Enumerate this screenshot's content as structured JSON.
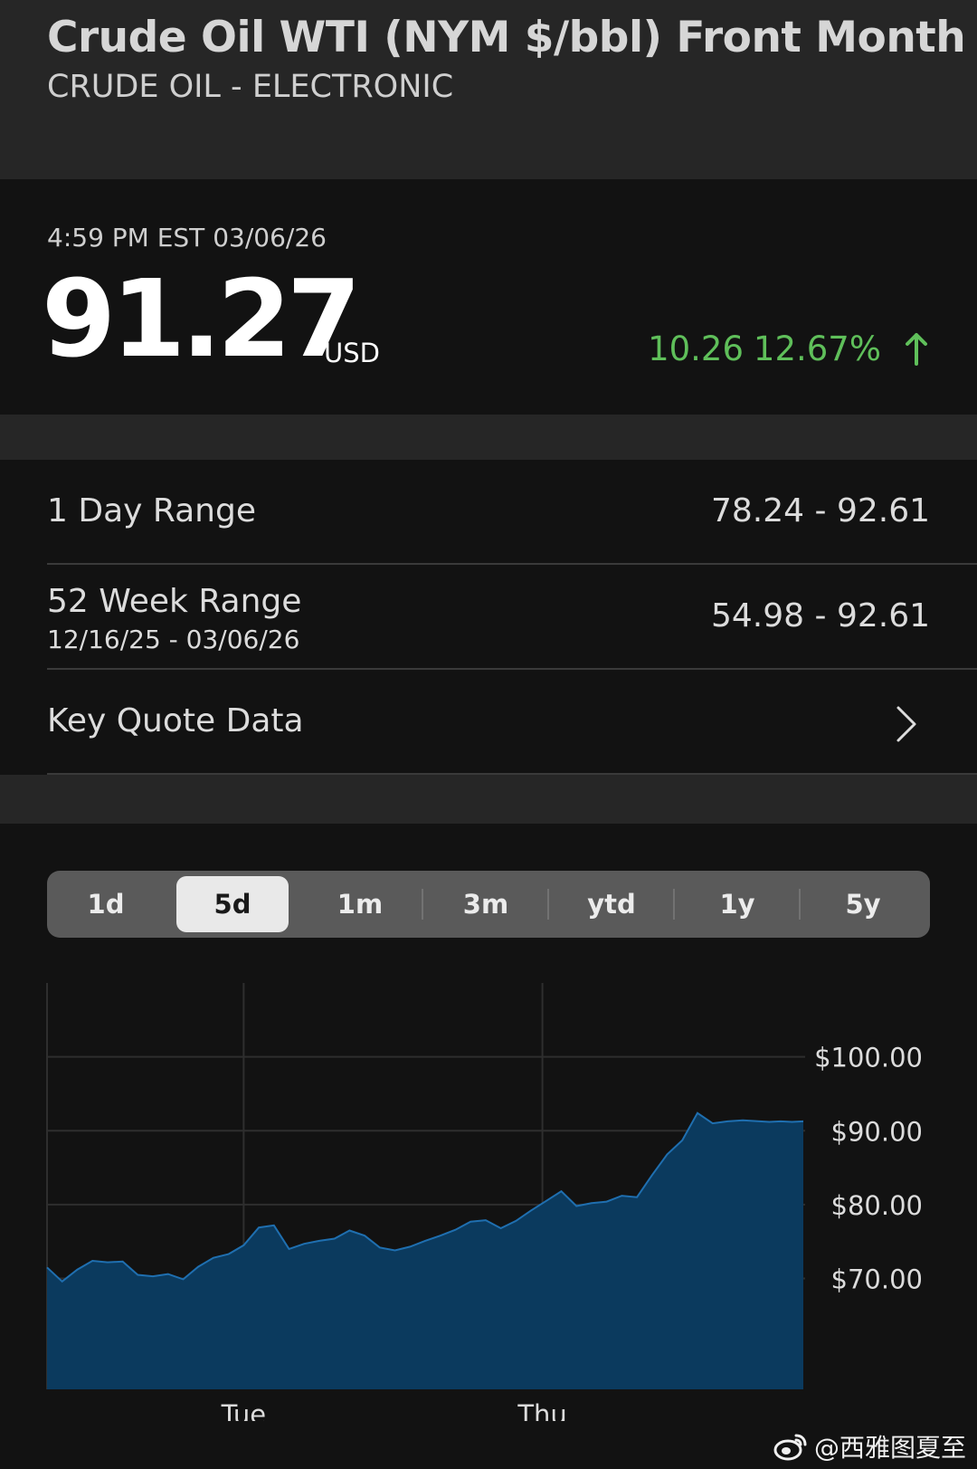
{
  "header": {
    "title": "Crude Oil WTI (NYM $/bbl) Front Month",
    "subtitle": "CRUDE OIL - ELECTRONIC"
  },
  "quote": {
    "timestamp": "4:59 PM EST 03/06/26",
    "price": "91.27",
    "currency": "USD",
    "change_abs": "10.26",
    "change_pct": "12.67%",
    "direction_icon": "arrow-up-icon",
    "change_color": "#5fbf5a"
  },
  "ranges": {
    "day": {
      "label": "1 Day Range",
      "value": "78.24 - 92.61"
    },
    "week52": {
      "label": "52 Week Range",
      "sublabel": "12/16/25 - 03/06/26",
      "value": "54.98 - 92.61"
    },
    "key_quote": {
      "label": "Key Quote Data",
      "icon": "chevron-right-icon"
    }
  },
  "tabs": [
    {
      "label": "1d"
    },
    {
      "label": "5d",
      "active": true
    },
    {
      "label": "1m"
    },
    {
      "label": "3m"
    },
    {
      "label": "ytd"
    },
    {
      "label": "1y"
    },
    {
      "label": "5y"
    }
  ],
  "chart_data": {
    "type": "area",
    "series_color": "#0b3a5e",
    "line_color": "#1f6fb0",
    "ylim": [
      55,
      110
    ],
    "y_ticks": [
      {
        "value": 100,
        "label": "$100.00"
      },
      {
        "value": 90,
        "label": "$90.00"
      },
      {
        "value": 80,
        "label": "$80.00"
      },
      {
        "value": 70,
        "label": "$70.00"
      }
    ],
    "x_ticks": [
      {
        "x": 26,
        "label": "Tue"
      },
      {
        "x": 65.5,
        "label": "Thu"
      }
    ],
    "xlim": [
      0,
      100
    ],
    "x": [
      0,
      2,
      4,
      6,
      8,
      10,
      12,
      14,
      16,
      18,
      20,
      22,
      24,
      26,
      28,
      30,
      32,
      34,
      36,
      38,
      40,
      42,
      44,
      46,
      48,
      50,
      52,
      54,
      56,
      58,
      60,
      62,
      64,
      66,
      68,
      70,
      72,
      74,
      76,
      78,
      80,
      82,
      84,
      86,
      88,
      90,
      92,
      94,
      95.5,
      97,
      98.5,
      100
    ],
    "values": [
      71.5,
      69.6,
      71.2,
      72.4,
      72.2,
      72.3,
      70.5,
      70.3,
      70.6,
      69.9,
      71.6,
      72.8,
      73.3,
      74.5,
      76.9,
      77.2,
      74.0,
      74.7,
      75.1,
      75.4,
      76.5,
      75.8,
      74.2,
      73.8,
      74.3,
      75.1,
      75.8,
      76.6,
      77.7,
      77.9,
      76.8,
      77.8,
      79.2,
      80.5,
      81.8,
      79.8,
      80.2,
      80.4,
      81.2,
      81.0,
      84.0,
      86.8,
      88.7,
      92.4,
      91.0,
      91.27,
      91.4,
      91.3,
      91.2,
      91.27,
      91.2,
      91.27
    ],
    "grid": true
  },
  "watermark": {
    "text": "@西雅图夏至",
    "icon": "weibo-icon"
  }
}
